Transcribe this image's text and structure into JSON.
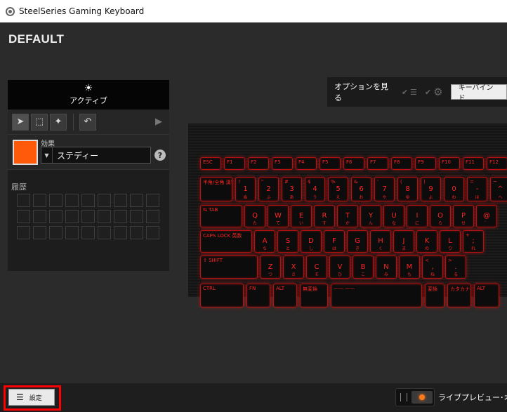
{
  "window": {
    "title": "SteelSeries Gaming Keyboard"
  },
  "profile": {
    "name": "DEFAULT"
  },
  "left_panel": {
    "mode_label": "アクティブ",
    "effect_label": "効果",
    "effect_value": "ステディー",
    "help": "?",
    "history_label": "履歴",
    "swatch_color": "#ff5a0a"
  },
  "options": {
    "label": "オプションを見る",
    "keybind_button": "キーバインド"
  },
  "keyboard": {
    "rows": [
      [
        {
          "p": "ESC"
        },
        {
          "p": "F1"
        },
        {
          "p": "F2"
        },
        {
          "p": "F3"
        },
        {
          "p": "F4"
        },
        {
          "p": "F5"
        },
        {
          "p": "F6"
        },
        {
          "p": "F7"
        },
        {
          "p": "F8"
        },
        {
          "p": "F9"
        },
        {
          "p": "F10"
        },
        {
          "p": "F11"
        },
        {
          "p": "F12"
        }
      ],
      [
        {
          "p": "半角/全角 漢字"
        },
        {
          "c": "1",
          "k": "ぬ",
          "p": "!"
        },
        {
          "c": "2",
          "k": "ふ",
          "p": "\""
        },
        {
          "c": "3",
          "k": "あ",
          "p": "#"
        },
        {
          "c": "4",
          "k": "う",
          "p": "$"
        },
        {
          "c": "5",
          "k": "え",
          "p": "%"
        },
        {
          "c": "6",
          "k": "お",
          "p": "&"
        },
        {
          "c": "7",
          "k": "や",
          "p": "'"
        },
        {
          "c": "8",
          "k": "ゆ",
          "p": "("
        },
        {
          "c": "9",
          "k": "よ",
          "p": ")"
        },
        {
          "c": "0",
          "k": "わ"
        },
        {
          "c": "-",
          "k": "ほ",
          "p": "="
        },
        {
          "c": "^",
          "k": "へ",
          "p": "~"
        }
      ],
      [
        {
          "p": "⇆ TAB"
        },
        {
          "c": "Q",
          "k": "た"
        },
        {
          "c": "W",
          "k": "て"
        },
        {
          "c": "E",
          "k": "い"
        },
        {
          "c": "R",
          "k": "す"
        },
        {
          "c": "T",
          "k": "か"
        },
        {
          "c": "Y",
          "k": "ん"
        },
        {
          "c": "U",
          "k": "な"
        },
        {
          "c": "I",
          "k": "に"
        },
        {
          "c": "O",
          "k": "ら"
        },
        {
          "c": "P",
          "k": "せ"
        },
        {
          "c": "@",
          "k": "゛"
        }
      ],
      [
        {
          "p": "CAPS LOCK 英数"
        },
        {
          "c": "A",
          "k": "ち"
        },
        {
          "c": "S",
          "k": "と"
        },
        {
          "c": "D",
          "k": "し"
        },
        {
          "c": "F",
          "k": "は"
        },
        {
          "c": "G",
          "k": "き"
        },
        {
          "c": "H",
          "k": "く"
        },
        {
          "c": "J",
          "k": "ま"
        },
        {
          "c": "K",
          "k": "の"
        },
        {
          "c": "L",
          "k": "り"
        },
        {
          "c": ";",
          "k": "れ",
          "p": "+"
        }
      ],
      [
        {
          "p": "⇧ SHIFT"
        },
        {
          "c": "Z",
          "k": "つ"
        },
        {
          "c": "X",
          "k": "さ"
        },
        {
          "c": "C",
          "k": "そ"
        },
        {
          "c": "V",
          "k": "ひ"
        },
        {
          "c": "B",
          "k": "こ"
        },
        {
          "c": "N",
          "k": "み"
        },
        {
          "c": "M",
          "k": "も"
        },
        {
          "c": ",",
          "k": "ね",
          "p": "<"
        },
        {
          "c": ".",
          "k": "る",
          "p": ">"
        }
      ],
      [
        {
          "p": "CTRL"
        },
        {
          "p": "FN"
        },
        {
          "p": "ALT"
        },
        {
          "p": "無変換"
        },
        {
          "p": "—— ——"
        },
        {
          "p": "変換"
        },
        {
          "p": "カタカナ ひらがな ローマ字"
        },
        {
          "p": "ALT"
        }
      ]
    ]
  },
  "footer": {
    "settings_label": "設定",
    "live_preview": "ライブプレビュー･オン"
  }
}
